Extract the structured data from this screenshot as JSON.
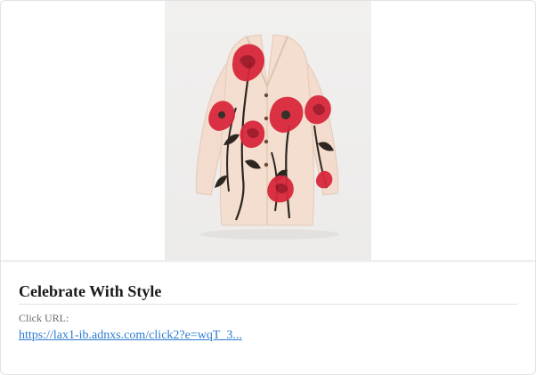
{
  "image": {
    "subject": "cardigan-with-red-poppy-print",
    "colors": {
      "background": "#eeeeed",
      "garment": "#f3dccd",
      "flower": "#d8283c",
      "flower_dark": "#9e1526",
      "stem": "#2d2620",
      "button": "#6c4a34"
    }
  },
  "card": {
    "title": "Celebrate With Style",
    "url_label": "Click URL:",
    "url_text": "https://lax1-ib.adnxs.com/click2?e=wqT_3..."
  },
  "colors": {
    "title": "#1a1a1a",
    "label": "#6b6b6b",
    "link": "#2a7bd1",
    "border": "#e2e2e2"
  }
}
